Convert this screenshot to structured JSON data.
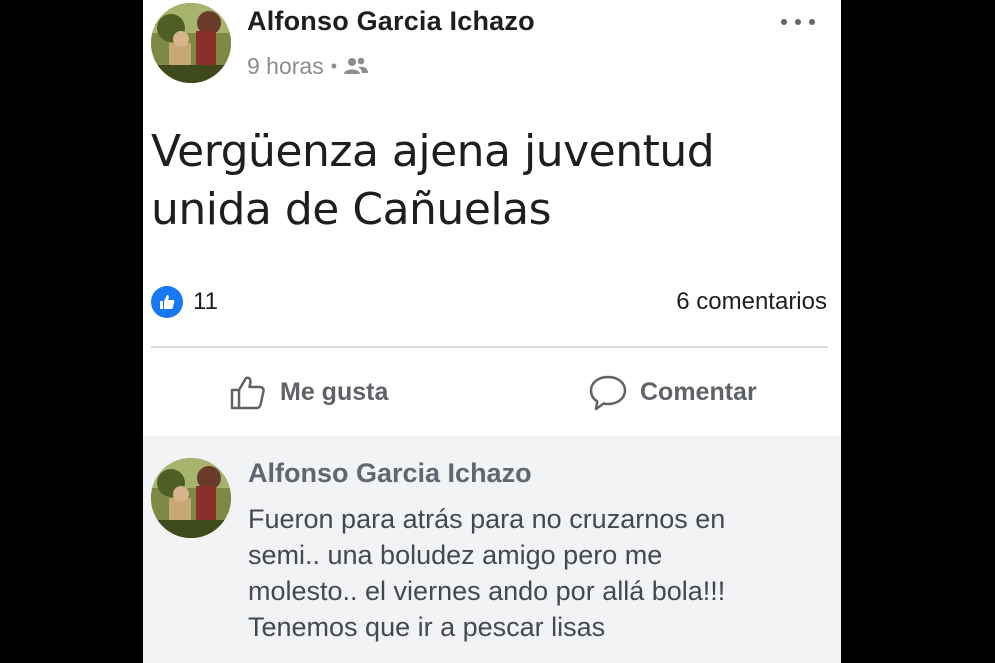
{
  "post": {
    "author": "Alfonso Garcia Ichazo",
    "time": "9 horas",
    "separator": "•",
    "audience_icon": "friends-icon",
    "more_icon": "more-options-icon",
    "text": "Vergüenza ajena juventud unida de Cañuelas"
  },
  "stats": {
    "like_count": "11",
    "comments": "6 comentarios"
  },
  "actions": {
    "like_label": "Me gusta",
    "comment_label": "Comentar"
  },
  "comment": {
    "author": "Alfonso Garcia Ichazo",
    "lines": [
      "Fueron para atrás para no cruzarnos en",
      "semi.. una boludez amigo pero me",
      "molesto.. el viernes ando por allá bola!!!",
      "Tenemos que ir a pescar lisas"
    ]
  },
  "colors": {
    "facebook_blue": "#1877f2",
    "comment_background": "#f2f3f5"
  }
}
